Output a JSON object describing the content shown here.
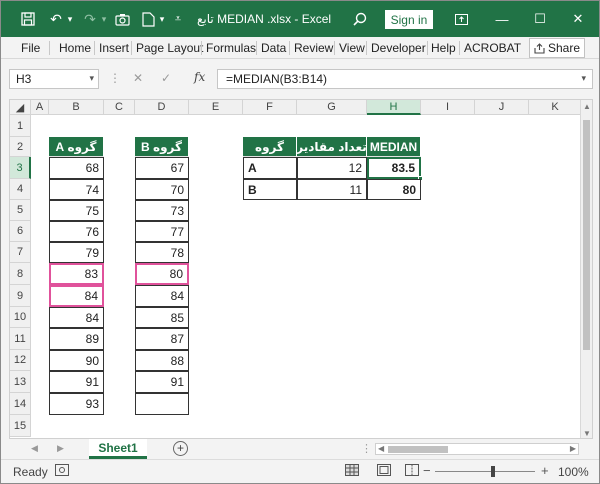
{
  "titlebar": {
    "title": "تابع MEDIAN .xlsx  -  Excel",
    "signin": "Sign in",
    "save_icon": "save-icon",
    "undo_icon": "undo-icon",
    "redo_icon": "redo-icon",
    "colors": {
      "brand": "#217346"
    }
  },
  "menu": [
    "File",
    "Home",
    "Insert",
    "Page Layout",
    "Formulas",
    "Data",
    "Review",
    "View",
    "Developer",
    "Help",
    "ACROBAT"
  ],
  "share_label": "Share",
  "namebox": "H3",
  "formula": "=MEDIAN(B3:B14)",
  "fx_label": "fx",
  "columns": [
    "A",
    "B",
    "C",
    "D",
    "E",
    "F",
    "G",
    "H",
    "I",
    "J",
    "K"
  ],
  "rows": [
    "1",
    "2",
    "3",
    "4",
    "5",
    "6",
    "7",
    "8",
    "9",
    "10",
    "11",
    "12",
    "13",
    "14",
    "15"
  ],
  "table_a": {
    "header": "گروه A",
    "values": [
      "68",
      "74",
      "75",
      "76",
      "79",
      "83",
      "84",
      "84",
      "89",
      "90",
      "91",
      "93"
    ]
  },
  "table_b": {
    "header": "گروه B",
    "values": [
      "67",
      "70",
      "73",
      "77",
      "78",
      "80",
      "84",
      "85",
      "87",
      "88",
      "91",
      ""
    ]
  },
  "summary": {
    "headers": [
      "گروه",
      "تعداد مقادیر",
      "MEDIAN"
    ],
    "rows": [
      {
        "group": "A",
        "count": "12",
        "median": "83.5"
      },
      {
        "group": "B",
        "count": "11",
        "median": "80"
      }
    ]
  },
  "sheet_tab": "Sheet1",
  "status": "Ready",
  "zoom": "100%"
}
